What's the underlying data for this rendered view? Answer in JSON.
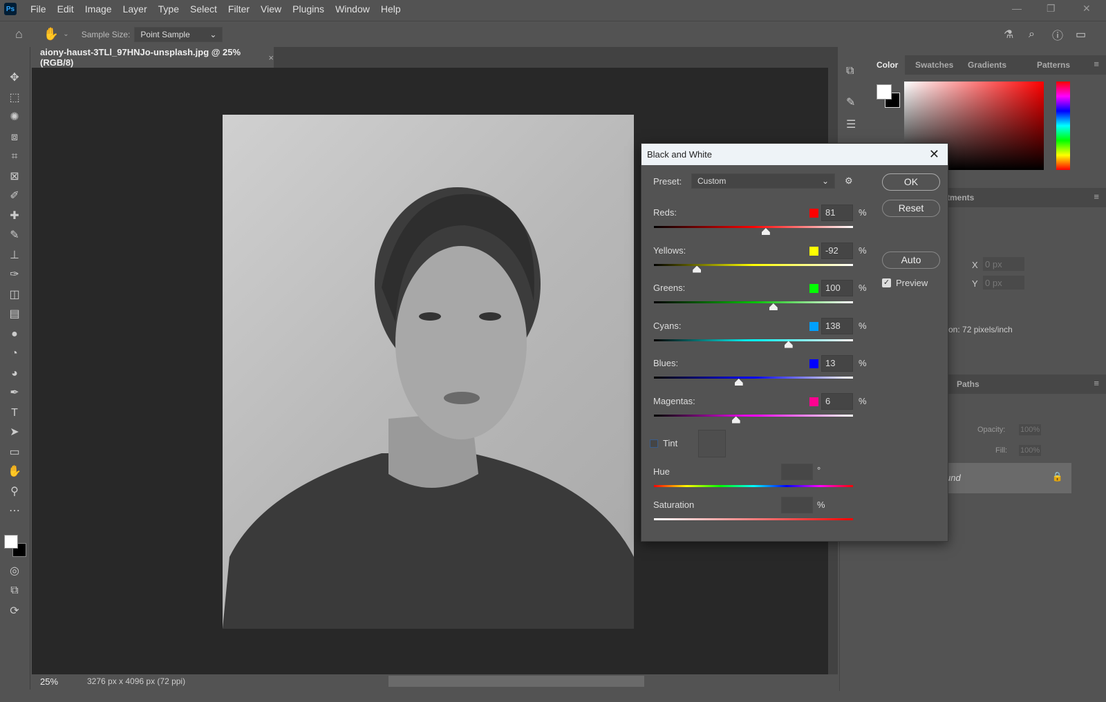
{
  "app": {
    "logo": "Ps",
    "menu": [
      "File",
      "Edit",
      "Image",
      "Layer",
      "Type",
      "Select",
      "Filter",
      "View",
      "Plugins",
      "Window",
      "Help"
    ]
  },
  "options": {
    "sample_size_label": "Sample Size:",
    "sample_size_value": "Point Sample"
  },
  "document": {
    "tab_title": "aiony-haust-3TLl_97HNJo-unsplash.jpg @ 25% (RGB/8)",
    "close": "×"
  },
  "status": {
    "zoom": "25%",
    "dimensions": "3276 px x 4096 px (72 ppi)"
  },
  "panels": {
    "color_tabs": [
      "Color",
      "Swatches",
      "Gradients",
      "Patterns"
    ],
    "adjustments_tab": "tments",
    "properties": {
      "x_label": "X",
      "x_value": "0 px",
      "y_label": "Y",
      "y_value": "0 px",
      "resolution": "on: 72 pixels/inch"
    },
    "layers_tab": "Paths",
    "opacity_label": "Opacity:",
    "opacity_value": "100%",
    "fill_label": "Fill:",
    "fill_value": "100%",
    "layer_name": "und"
  },
  "dialog": {
    "title": "Black and White",
    "preset_label": "Preset:",
    "preset_value": "Custom",
    "ok": "OK",
    "reset": "Reset",
    "auto": "Auto",
    "preview_label": "Preview",
    "preview_checked": true,
    "slider_range": [
      -200,
      300
    ],
    "sliders": [
      {
        "label": "Reds:",
        "value": "81",
        "color": "#ff0000",
        "grad": "#000,#ff0000,#fff"
      },
      {
        "label": "Yellows:",
        "value": "-92",
        "color": "#ffff00",
        "grad": "#000,#ffff00,#fff"
      },
      {
        "label": "Greens:",
        "value": "100",
        "color": "#00ff00",
        "grad": "#000,#00c000,#fff"
      },
      {
        "label": "Cyans:",
        "value": "138",
        "color": "#00a0ff",
        "grad": "#000,#00ffff,#fff"
      },
      {
        "label": "Blues:",
        "value": "13",
        "color": "#0000ff",
        "grad": "#000,#0000ff,#fff"
      },
      {
        "label": "Magentas:",
        "value": "6",
        "color": "#ff0090",
        "grad": "#000,#ff00ff,#fff"
      }
    ],
    "pct": "%",
    "tint_label": "Tint",
    "tint_checked": false,
    "hue_label": "Hue",
    "hue_unit": "°",
    "saturation_label": "Saturation",
    "saturation_unit": "%"
  }
}
